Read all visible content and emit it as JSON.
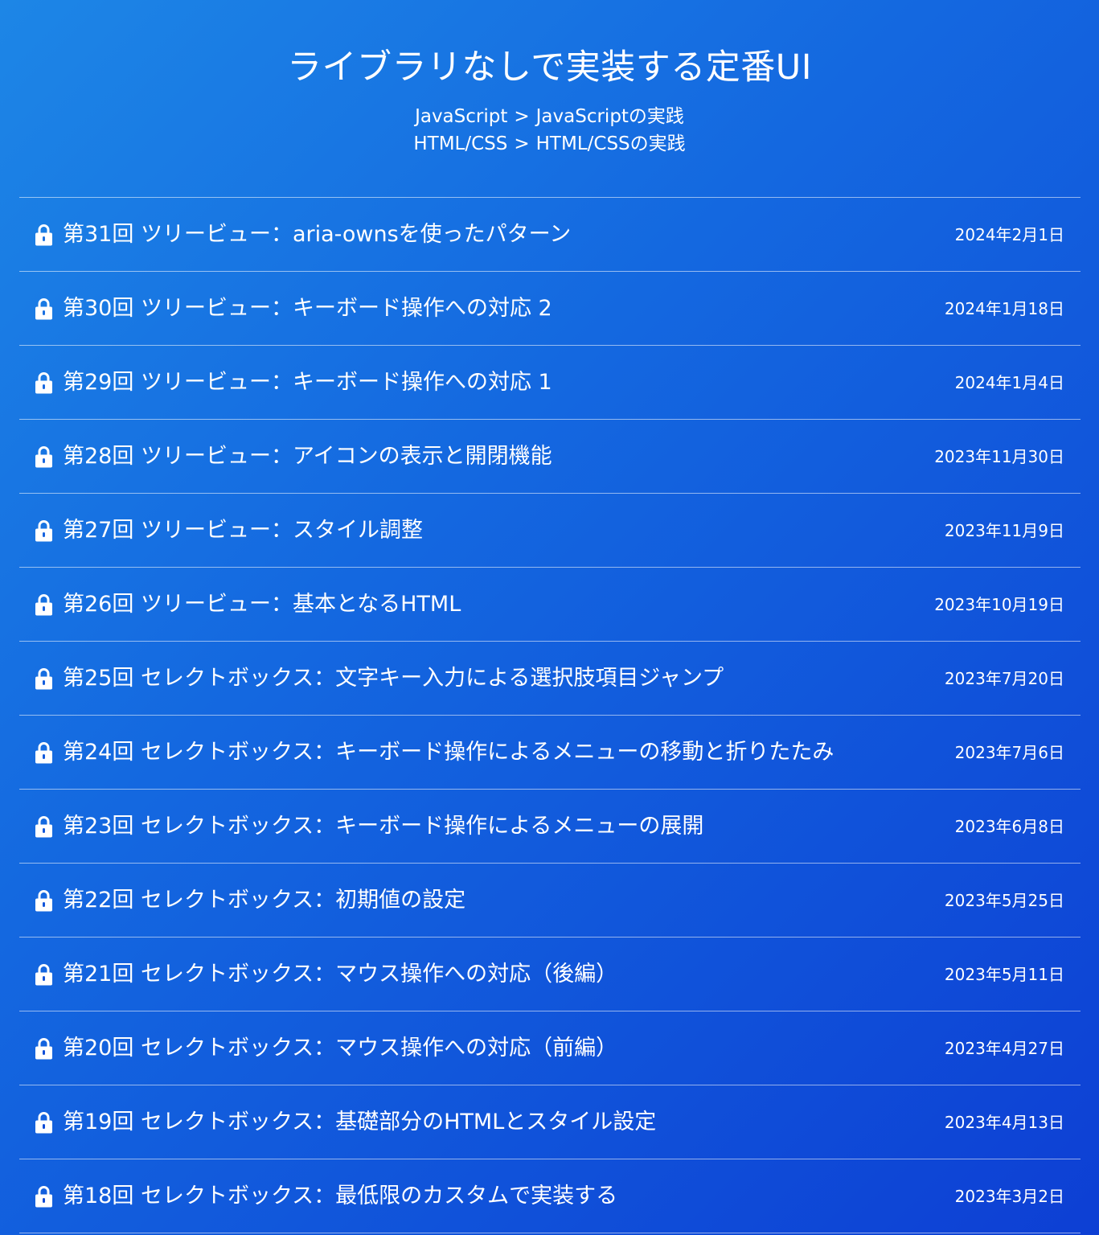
{
  "header": {
    "title": "ライブラリなしで実装する定番UI",
    "breadcrumbs": [
      {
        "parent": "JavaScript",
        "separator": ">",
        "child": "JavaScriptの実践"
      },
      {
        "parent": "HTML/CSS",
        "separator": ">",
        "child": "HTML/CSSの実践"
      }
    ]
  },
  "icons": {
    "lock": "lock-icon"
  },
  "colors": {
    "background_start": "#1d86e6",
    "background_end": "#0d3fd4",
    "text": "#ffffff"
  },
  "articles": [
    {
      "title": "第31回 ツリービュー：aria-ownsを使ったパターン",
      "date": "2024年2月1日"
    },
    {
      "title": "第30回 ツリービュー：キーボード操作への対応 2",
      "date": "2024年1月18日"
    },
    {
      "title": "第29回 ツリービュー：キーボード操作への対応 1",
      "date": "2024年1月4日"
    },
    {
      "title": "第28回 ツリービュー：アイコンの表示と開閉機能",
      "date": "2023年11月30日"
    },
    {
      "title": "第27回 ツリービュー：スタイル調整",
      "date": "2023年11月9日"
    },
    {
      "title": "第26回 ツリービュー：基本となるHTML",
      "date": "2023年10月19日"
    },
    {
      "title": "第25回 セレクトボックス：文字キー入力による選択肢項目ジャンプ",
      "date": "2023年7月20日"
    },
    {
      "title": "第24回 セレクトボックス：キーボード操作によるメニューの移動と折りたたみ",
      "date": "2023年7月6日"
    },
    {
      "title": "第23回 セレクトボックス：キーボード操作によるメニューの展開",
      "date": "2023年6月8日"
    },
    {
      "title": "第22回 セレクトボックス：初期値の設定",
      "date": "2023年5月25日"
    },
    {
      "title": "第21回 セレクトボックス：マウス操作への対応（後編）",
      "date": "2023年5月11日"
    },
    {
      "title": "第20回 セレクトボックス：マウス操作への対応（前編）",
      "date": "2023年4月27日"
    },
    {
      "title": "第19回 セレクトボックス：基礎部分のHTMLとスタイル設定",
      "date": "2023年4月13日"
    },
    {
      "title": "第18回 セレクトボックス：最低限のカスタムで実装する",
      "date": "2023年3月2日"
    }
  ]
}
